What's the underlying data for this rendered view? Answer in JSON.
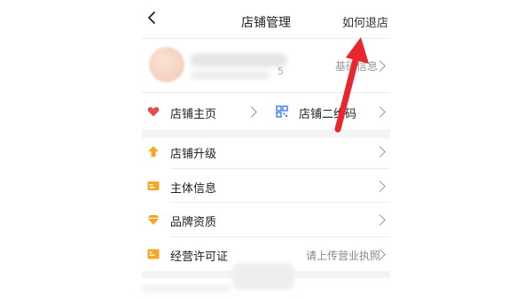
{
  "header": {
    "title": "店铺管理",
    "right_link": "如何退店"
  },
  "profile": {
    "subtitle_suffix": "5",
    "basic_info_label": "基础信息"
  },
  "quick_links": [
    {
      "label": "店铺主页",
      "icon": "heart-icon"
    },
    {
      "label": "店铺二维码",
      "icon": "qr-code-icon"
    }
  ],
  "menu": [
    {
      "label": "店铺升级",
      "icon": "upgrade-arrow-icon",
      "hint": ""
    },
    {
      "label": "主体信息",
      "icon": "id-card-icon",
      "hint": ""
    },
    {
      "label": "品牌资质",
      "icon": "diamond-icon",
      "hint": ""
    },
    {
      "label": "经营许可证",
      "icon": "license-icon",
      "hint": "请上传营业执照"
    }
  ],
  "colors": {
    "accent_orange": "#f5a623",
    "heart_red": "#e84b4b",
    "qr_blue": "#3b7ded",
    "annotation_arrow": "#e8262d"
  }
}
